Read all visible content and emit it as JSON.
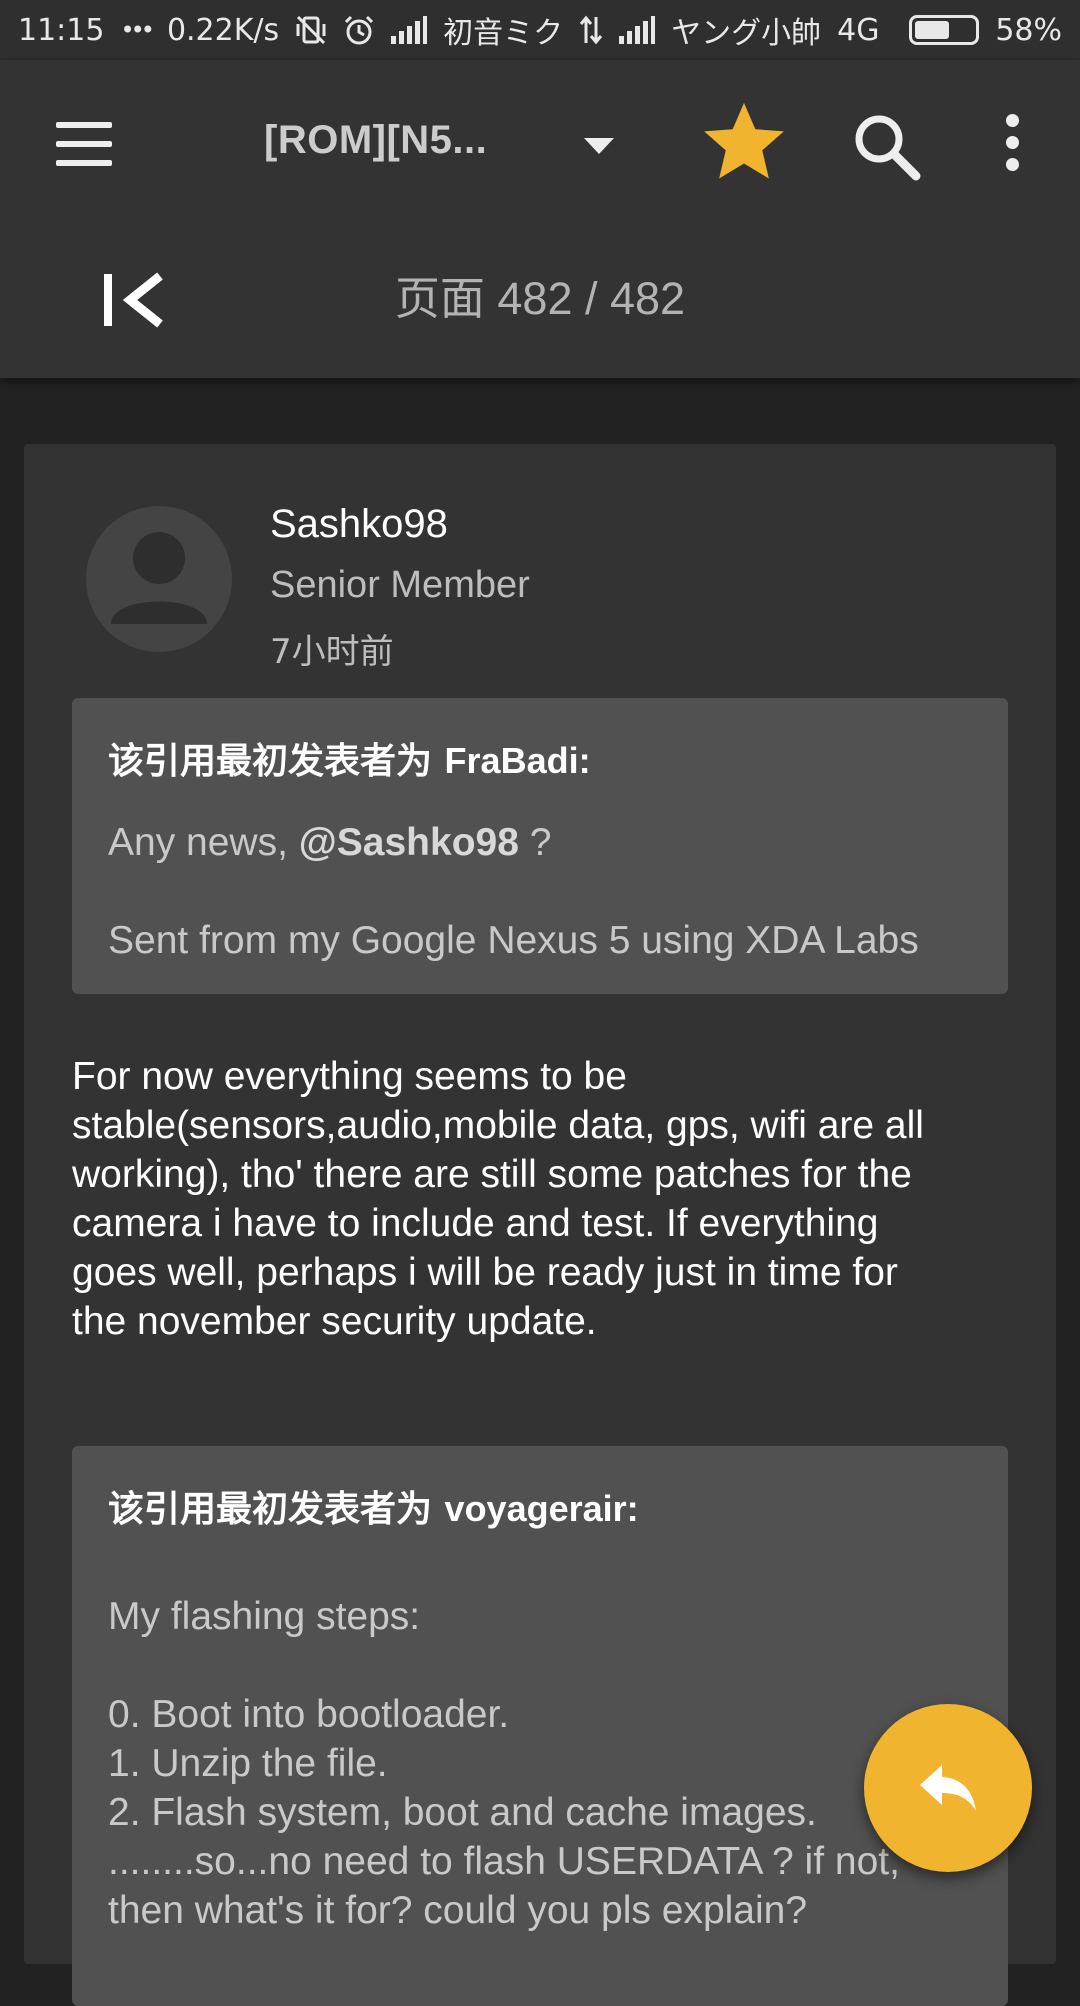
{
  "status_bar": {
    "time": "11:15",
    "dots": "•••",
    "speed": "0.22K/s",
    "carrier1": "初音ミク",
    "carrier2": "ヤング小帥",
    "network": "4G",
    "battery": "58%",
    "battery_level": 0.58
  },
  "toolbar": {
    "title": "[ROM][N5...",
    "accent_color": "#f0b42f"
  },
  "pagination": {
    "label": "页面 482 / 482"
  },
  "post": {
    "author": "Sashko98",
    "rank": "Senior Member",
    "time": "7小时前",
    "quote1": {
      "prefix": "该引用最初发表者为 ",
      "name": "FraBadi:",
      "line1_pre": "Any news, ",
      "line1_mention": "@Sashko98",
      "line1_post": " ?",
      "line2": "Sent from my Google Nexus 5 using XDA Labs"
    },
    "body": [
      "For now everything seems to be",
      "stable(sensors,audio,mobile data, gps, wifi are all",
      "working), tho' there are still some patches for the",
      "camera i have to include and test. If everything",
      "goes well, perhaps i will be ready just in time for",
      "the november security update."
    ],
    "quote2": {
      "prefix": "该引用最初发表者为 ",
      "name": "voyagerair:",
      "lines": [
        "My flashing steps:",
        "",
        "0. Boot into bootloader.",
        "1. Unzip the file.",
        "2. Flash system, boot and cache images.",
        "........so...no need to flash USERDATA ? if not,",
        "then what's it for? could you pls explain?"
      ]
    }
  }
}
